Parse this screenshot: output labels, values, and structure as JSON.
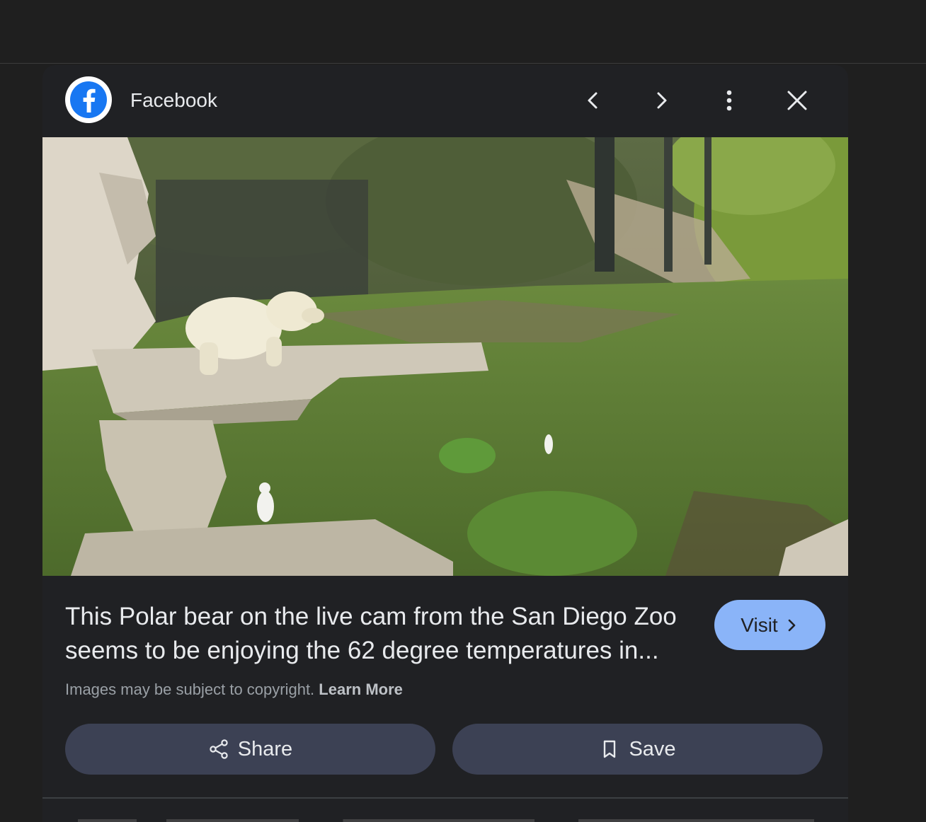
{
  "header": {
    "source_name": "Facebook",
    "logo_icon": "facebook-logo-icon",
    "prev_icon": "chevron-left-icon",
    "next_icon": "chevron-right-icon",
    "more_icon": "more-vert-icon",
    "close_icon": "close-icon"
  },
  "image": {
    "lens_icon": "google-lens-icon"
  },
  "result": {
    "caption": "This Polar bear on the live cam from the San Diego Zoo seems to be enjoying the 62 degree temperatures in...",
    "visit_label": "Visit",
    "copyright_text": "Images may be subject to copyright.",
    "learn_more_label": "Learn More"
  },
  "actions": {
    "share_label": "Share",
    "save_label": "Save"
  },
  "colors": {
    "background": "#1f1f1f",
    "panel": "#202124",
    "visit_button": "#8ab4f8",
    "action_button": "#3c4154",
    "facebook_blue": "#1877f2"
  }
}
